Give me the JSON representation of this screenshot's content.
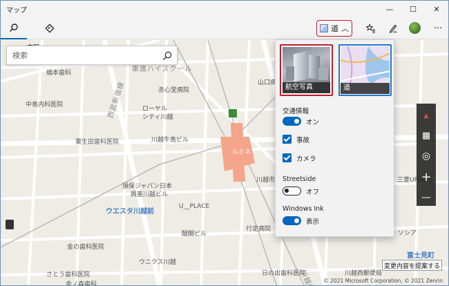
{
  "app": {
    "title": "マップ"
  },
  "window_controls": {
    "minimize": "—",
    "maximize": "☐",
    "close": "✕"
  },
  "toolbar": {
    "view_button_label": "道",
    "view_button_chevron": "︿",
    "more": "···"
  },
  "search": {
    "placeholder": "検索"
  },
  "flyout": {
    "map_styles": [
      {
        "label": "航空写真",
        "selected": false
      },
      {
        "label": "道",
        "selected": true
      }
    ],
    "traffic": {
      "heading": "交通情報",
      "state": "オン",
      "on": true
    },
    "checkboxes": [
      {
        "label": "事故",
        "checked": true
      },
      {
        "label": "カメラ",
        "checked": true
      }
    ],
    "streetside": {
      "heading": "Streetside",
      "state": "オフ",
      "on": false
    },
    "ink": {
      "heading": "Windows Ink",
      "state": "表示",
      "on": true
    }
  },
  "map_controls": {
    "compass": "▲",
    "tilt": "▦",
    "locate": "◎",
    "zoom_in": "+",
    "zoom_out": "—"
  },
  "map_labels": {
    "l1": "本町",
    "l2": "橋本歯科",
    "l3": "東進ハイスクール",
    "l4": "赤心堂病院",
    "l5": "中島内科医院",
    "l6": "西武新宿線",
    "l7": "ローヤル",
    "l8": "シティ川越",
    "l9": "栗生田歯科医院",
    "l10": "川越牛島ビル",
    "l11": "ルミネ",
    "l12": "川越市",
    "l13": "損保ジャパン日本",
    "l14": "興亜川越ビル",
    "l15": "ウエスタ川越前",
    "l16": "U__PLACE",
    "l17": "醍醐ビル",
    "l18": "行定病院",
    "l19": "ウニクス川越",
    "l20": "金の歯科医院",
    "l21": "さとう歯科医院",
    "l22": "川越線",
    "l23": "日の出歯科医院",
    "l24": "富士見町",
    "l25": "山口病院",
    "l26": "ソシア",
    "l27": "三菱UFJ銀行",
    "l28": "川越西郵便局",
    "l29": "金ノ森歯科"
  },
  "suggest_button": "変更内容を提案する",
  "copyright": "© 2021 Microsoft Corporation, © 2021 Zenrin",
  "colors": {
    "accent": "#0067c0",
    "highlight": "#c0182a",
    "map_bg": "#efece6",
    "station": "#f4a58a"
  }
}
